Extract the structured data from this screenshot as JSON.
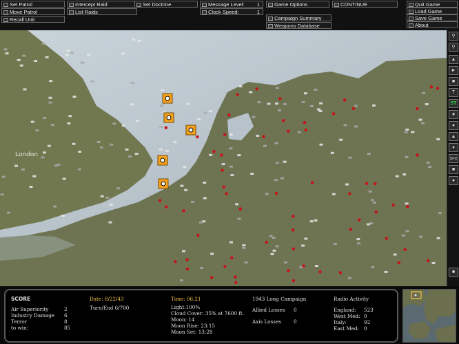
{
  "menu": {
    "set_patrol": "Set Patrol",
    "move_patrol": "Move Patrol",
    "recall_unit": "Recall Unit",
    "intercept_raid": "Intercept Raid",
    "list_raids": "List Raids",
    "set_doctrine": "Set Doctrine",
    "message_level": "Message Level:",
    "message_level_value": "1",
    "clock_speed": "Clock Speed:",
    "clock_speed_value": "1",
    "game_options": "Game Options",
    "campaign_summary": "Campaign Summary",
    "weapons_database": "Weapons Database",
    "continue": "CONTINUE",
    "quit_game": "Quit Game",
    "load_game": "Load Game",
    "save_game": "Save Game",
    "about": "About"
  },
  "sidebar": {
    "buttons": [
      "zoom-in-icon",
      "zoom-out-icon",
      "T",
      "ST",
      "SFX"
    ]
  },
  "map": {
    "city_labels": [
      "London"
    ],
    "colors": {
      "sea": "#bcc7cf",
      "land": "#6d7250",
      "allied": "#f4a21d",
      "axis": "#c8121b"
    }
  },
  "score": {
    "title": "SCORE",
    "rows": [
      {
        "label": "Air Superiority",
        "value": "2"
      },
      {
        "label": "Industry Damage",
        "value": "6"
      },
      {
        "label": "Terror",
        "value": "8"
      },
      {
        "label": "to win:",
        "value": "85"
      }
    ]
  },
  "turn": {
    "date": "Date: 8/22/43",
    "turn_end": "Turn/End 6/700"
  },
  "weather": {
    "time": "Time: 06:21",
    "light": "Light:100%",
    "cloud": "Cloud Cover: 35% at 7600 ft.",
    "moon": "Moon: 14",
    "moon_rise": "Moon Rise: 23:15",
    "moon_set": "Moon Set: 13:28"
  },
  "campaign": {
    "name": "1943 Long Campaign",
    "allied_losses_label": "Allied Losses",
    "allied_losses_value": "0",
    "axis_losses_label": "Axis Losses",
    "axis_losses_value": "0"
  },
  "radio": {
    "title": "Radio Activity",
    "rows": [
      {
        "label": "England:",
        "value": "523"
      },
      {
        "label": "West Med:",
        "value": "0"
      },
      {
        "label": "Italy:",
        "value": "92"
      },
      {
        "label": "East Med:",
        "value": "0"
      }
    ]
  }
}
